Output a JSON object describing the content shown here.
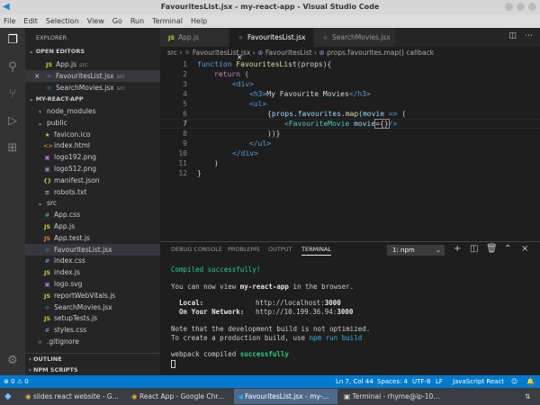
{
  "window": {
    "title": "FavouritesList.jsx - my-react-app - Visual Studio Code"
  },
  "menu": [
    "File",
    "Edit",
    "Selection",
    "View",
    "Go",
    "Run",
    "Terminal",
    "Help"
  ],
  "sidebar": {
    "title": "EXPLORER",
    "open_editors_label": "OPEN EDITORS",
    "open_editors": [
      {
        "name": "App.js",
        "dir": "src",
        "icon": "JS"
      },
      {
        "name": "FavouritesList.jsx",
        "dir": "src",
        "icon": "⚛"
      },
      {
        "name": "SearchMovies.jsx",
        "dir": "src",
        "icon": "⚛"
      }
    ],
    "project_label": "MY-REACT-APP",
    "tree": [
      {
        "name": "node_modules",
        "icon": "›",
        "color": "#ccc"
      },
      {
        "name": "public",
        "icon": "⌄",
        "color": "#ccc"
      },
      {
        "name": "favicon.ico",
        "icon": "★",
        "color": "#cbcb41"
      },
      {
        "name": "index.html",
        "icon": "<>",
        "color": "#e37933"
      },
      {
        "name": "logo192.png",
        "icon": "▣",
        "color": "#a074c4"
      },
      {
        "name": "logo512.png",
        "icon": "▣",
        "color": "#a074c4"
      },
      {
        "name": "manifest.json",
        "icon": "{}",
        "color": "#cbcb41"
      },
      {
        "name": "robots.txt",
        "icon": "≡",
        "color": "#aaa"
      },
      {
        "name": "src",
        "icon": "⌄",
        "color": "#ccc"
      },
      {
        "name": "App.css",
        "icon": "#",
        "color": "#519aba"
      },
      {
        "name": "App.js",
        "icon": "JS",
        "color": "#cbcb41"
      },
      {
        "name": "App.test.js",
        "icon": "JS",
        "color": "#e37933"
      },
      {
        "name": "FavouritesList.jsx",
        "icon": "⚛",
        "color": "#519aba"
      },
      {
        "name": "index.css",
        "icon": "#",
        "color": "#519aba"
      },
      {
        "name": "index.js",
        "icon": "JS",
        "color": "#cbcb41"
      },
      {
        "name": "logo.svg",
        "icon": "▣",
        "color": "#a074c4"
      },
      {
        "name": "reportWebVitals.js",
        "icon": "JS",
        "color": "#cbcb41"
      },
      {
        "name": "SearchMovies.jsx",
        "icon": "⚛",
        "color": "#519aba"
      },
      {
        "name": "setupTests.js",
        "icon": "JS",
        "color": "#cbcb41"
      },
      {
        "name": "styles.css",
        "icon": "#",
        "color": "#519aba"
      },
      {
        "name": ".gitignore",
        "icon": "◆",
        "color": "#41535b"
      }
    ],
    "outline_label": "OUTLINE",
    "npm_label": "NPM SCRIPTS"
  },
  "tabs": [
    {
      "label": "App.js",
      "icon": "JS"
    },
    {
      "label": "FavouritesList.jsx",
      "icon": "⚛",
      "close": "×"
    },
    {
      "label": "SearchMovies.jsx",
      "icon": "⚛"
    }
  ],
  "breadcrumb": [
    "src",
    "FavouritesList.jsx",
    "FavouritesList",
    "props.favourites.map() callback"
  ],
  "code": [
    "1",
    "2",
    "3",
    "4",
    "5",
    "6",
    "7",
    "8",
    "9",
    "10",
    "11",
    "12"
  ],
  "code_text": {
    "l1a": "function ",
    "l1b": "FavouritesList",
    "l1c": "(props){",
    "l2a": "return ",
    "l2b": "(",
    "l3": "<div>",
    "l4a": "<h3>",
    "l4b": "My Favourite Movies",
    "l4c": "</h3>",
    "l5": "<ul>",
    "l6a": "{props.favourites.",
    "l6b": "map",
    "l6c": "(movie ",
    "l6d": "=>",
    "l6e": " (",
    "l7a": "<",
    "l7b": "FavouriteMovie",
    "l7c": " movie",
    "l7d": "={}",
    "l7e": "/>",
    "l8": "))}",
    "l9": "</ul>",
    "l10": "</div>",
    "l11": ")",
    "l12": "}"
  },
  "panel": {
    "tabs": [
      "DEBUG CONSOLE",
      "PROBLEMS",
      "OUTPUT",
      "TERMINAL"
    ],
    "active_tab": "TERMINAL",
    "terminal_select": "1: npm",
    "terminal": {
      "compiled": "Compiled successfully!",
      "view_a": "You can now view ",
      "view_b": "my-react-app",
      "view_c": " in the browser.",
      "local_label": "  Local:",
      "local_url_a": "http://localhost:",
      "local_port": "3000",
      "net_label": "  On Your Network:",
      "net_url_a": "http://10.199.36.94:",
      "net_port": "3000",
      "note": "Note that the development build is not optimized.",
      "create_a": "To create a production build, use ",
      "create_b": "npm run build",
      ".": ".",
      "webpack_a": "webpack compiled ",
      "webpack_b": "successfully"
    }
  },
  "status": {
    "errors": "0",
    "warnings": "0",
    "position": "Ln 7, Col 44",
    "spaces": "Spaces: 4",
    "encoding": "UTF-8",
    "eol": "LF",
    "language": "JavaScript React"
  },
  "taskbar": [
    {
      "label": "slides react website - G..."
    },
    {
      "label": "React App - Google Chr..."
    },
    {
      "label": "FavouritesList.jsx - my-..."
    },
    {
      "label": "Terminal - rhyme@ip-10..."
    }
  ]
}
